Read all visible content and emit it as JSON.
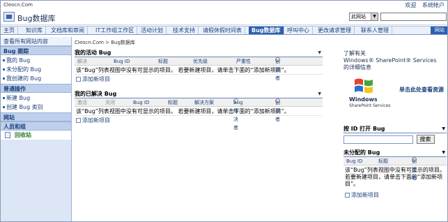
{
  "site_url": "Cleocn.Com",
  "welcome": [
    "欢迎",
    "系统帐户"
  ],
  "site_title": "Bug数据库",
  "scope_value": "此网站",
  "nav": [
    "主页",
    "知识库",
    "文档库和审阅",
    "IT工作组工作区",
    "活动计划",
    "技术支持",
    "请假休假时间表",
    "Bug数据库",
    "呼叫中心",
    "更改请求管理",
    "联系人管理"
  ],
  "nav_right": "网站",
  "sidebar": {
    "view_all": "查看所有网站内容",
    "sections": [
      {
        "title": "Bug 跟踪",
        "items": [
          "我的 Bug",
          "未分配的 Bug",
          "我创建的 Bug"
        ]
      },
      {
        "title": "普通操作",
        "items": [
          "新建 Bug",
          "创建 Bug 类别"
        ]
      },
      {
        "title": "网站",
        "items": []
      },
      {
        "title": "人员和组",
        "items": []
      }
    ],
    "recycle": "回收站"
  },
  "breadcrumb": {
    "root": "Cleocn.Com",
    "sep": " > ",
    "current": "Bug数据库"
  },
  "webparts": [
    {
      "title": "我的活动 Bug",
      "columns": [
        "解决",
        "Bug ID",
        "标题",
        "优先级",
        "严重性",
        "创建者"
      ],
      "empty": "该“Bug”列表视图中没有可显示的项目。 若要新建项目，请单击下面的“添加新项目”。",
      "add": "添加新项目"
    },
    {
      "title": "我的已解决 Bug",
      "columns": [
        "激活",
        "关闭",
        "Bug ID",
        "标题",
        "解决方案",
        "Bug 解决者",
        "创建者"
      ],
      "empty": "该“Bug”列表视图中没有可显示的项目。 若要新建项目，请单击下面的“添加新项目”。",
      "add": "添加新项目"
    }
  ],
  "right": {
    "info_title_1": "了解有关",
    "info_title_2": "Windows® SharePoint® Services",
    "info_title_3": "的详细信息",
    "win_text": "Windows",
    "win_sub": "SharePoint Services",
    "info_link": "单击此处查看资源",
    "open_title": "按 ID 打开 Bug",
    "search_btn": "搜索",
    "unassigned_title": "未分配的 Bug",
    "unassigned_cols": [
      "Bug ID",
      "标题",
      "创建者"
    ],
    "unassigned_msg": "该“Bug”列表视图中没有可显示的项目。 若要新建项目，请单击下面的“添加新项目”。",
    "unassigned_add": "添加新项目"
  }
}
